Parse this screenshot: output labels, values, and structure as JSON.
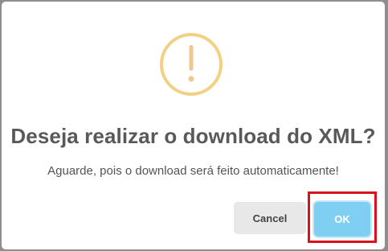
{
  "dialog": {
    "icon": "warning-exclamation-icon",
    "icon_color": "#f2d184",
    "title": "Deseja realizar o download do XML?",
    "message": "Aguarde, pois o download será feito automaticamente!",
    "cancel_label": "Cancel",
    "ok_label": "OK"
  },
  "colors": {
    "ok_button": "#7fcff3",
    "cancel_button": "#e8e8e8",
    "highlight": "#d9121e",
    "overlay": "#8e8e8e"
  }
}
